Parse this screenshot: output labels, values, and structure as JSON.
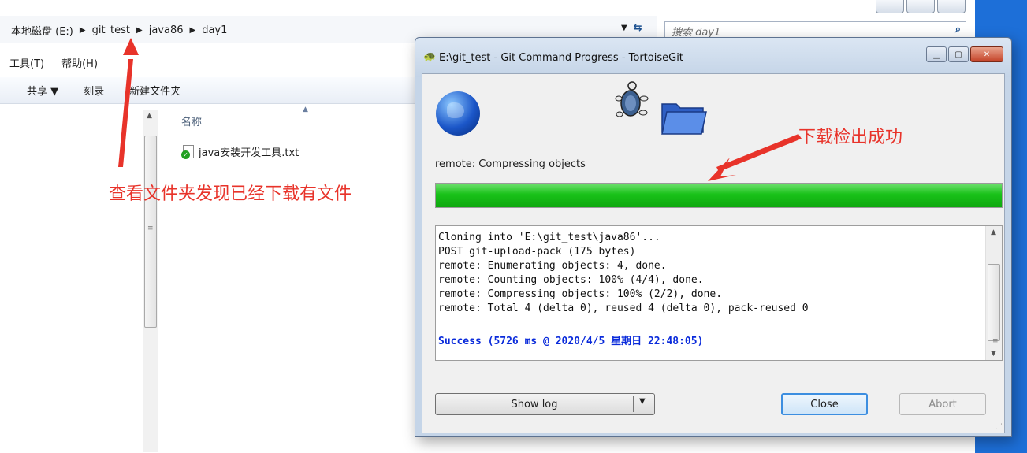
{
  "explorer": {
    "breadcrumb": [
      "本地磁盘 (E:)",
      "git_test",
      "java86",
      "day1"
    ],
    "search_placeholder": "搜索 day1",
    "menu": [
      "工具(T)",
      "帮助(H)"
    ],
    "toolbar": [
      "共享 ▼",
      "刻录",
      "新建文件夹"
    ],
    "column_name": "名称",
    "files": [
      {
        "name": "java安装开发工具.txt"
      }
    ]
  },
  "annotations": {
    "left": "查看文件夹发现已经下载有文件",
    "right": "下载检出成功",
    "color": "#e8332a"
  },
  "dialog": {
    "title": "E:\\git_test - Git Command Progress - TortoiseGit",
    "status": "remote: Compressing objects",
    "progress": 1.0,
    "log_lines": [
      "Cloning into 'E:\\git_test\\java86'...",
      "POST git-upload-pack (175 bytes)",
      "remote: Enumerating objects: 4, done.",
      "remote: Counting objects: 100% (4/4), done.",
      "remote: Compressing objects: 100% (2/2), done.",
      "remote: Total 4 (delta 0), reused 4 (delta 0), pack-reused 0"
    ],
    "success_line": "Success (5726 ms @ 2020/4/5 星期日 22:48:05)",
    "buttons": {
      "show_log": "Show log",
      "close": "Close",
      "abort": "Abort"
    },
    "icons": [
      "globe-icon",
      "tortoise-icon",
      "folder-icon"
    ],
    "colors": {
      "progress": "#19c219",
      "success": "#0a2bdb",
      "desktop": "#1d6fd8"
    }
  }
}
